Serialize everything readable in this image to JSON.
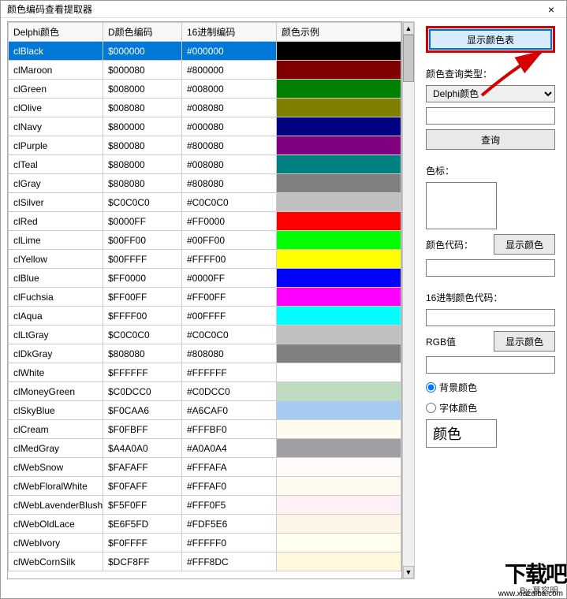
{
  "window": {
    "title": "颜色编码查看提取器",
    "close": "×"
  },
  "table": {
    "headers": [
      "Delphi颜色",
      "D颜色编码",
      "16进制编码",
      "颜色示例"
    ],
    "rows": [
      {
        "name": "clBlack",
        "dcode": "$000000",
        "hex": "#000000",
        "color": "#000000",
        "selected": true
      },
      {
        "name": "clMaroon",
        "dcode": "$000080",
        "hex": "#800000",
        "color": "#800000"
      },
      {
        "name": "clGreen",
        "dcode": "$008000",
        "hex": "#008000",
        "color": "#008000"
      },
      {
        "name": "clOlive",
        "dcode": "$008080",
        "hex": "#008080",
        "color": "#808000"
      },
      {
        "name": "clNavy",
        "dcode": "$800000",
        "hex": "#000080",
        "color": "#000080"
      },
      {
        "name": "clPurple",
        "dcode": "$800080",
        "hex": "#800080",
        "color": "#800080"
      },
      {
        "name": "clTeal",
        "dcode": "$808000",
        "hex": "#008080",
        "color": "#008080"
      },
      {
        "name": "clGray",
        "dcode": "$808080",
        "hex": "#808080",
        "color": "#808080"
      },
      {
        "name": "clSilver",
        "dcode": "$C0C0C0",
        "hex": "#C0C0C0",
        "color": "#C0C0C0"
      },
      {
        "name": "clRed",
        "dcode": "$0000FF",
        "hex": "#FF0000",
        "color": "#FF0000"
      },
      {
        "name": "clLime",
        "dcode": "$00FF00",
        "hex": "#00FF00",
        "color": "#00FF00"
      },
      {
        "name": "clYellow",
        "dcode": "$00FFFF",
        "hex": "#FFFF00",
        "color": "#FFFF00"
      },
      {
        "name": "clBlue",
        "dcode": "$FF0000",
        "hex": "#0000FF",
        "color": "#0000FF"
      },
      {
        "name": "clFuchsia",
        "dcode": "$FF00FF",
        "hex": "#FF00FF",
        "color": "#FF00FF"
      },
      {
        "name": "clAqua",
        "dcode": "$FFFF00",
        "hex": "#00FFFF",
        "color": "#00FFFF"
      },
      {
        "name": "clLtGray",
        "dcode": "$C0C0C0",
        "hex": "#C0C0C0",
        "color": "#C0C0C0"
      },
      {
        "name": "clDkGray",
        "dcode": "$808080",
        "hex": "#808080",
        "color": "#808080"
      },
      {
        "name": "clWhite",
        "dcode": "$FFFFFF",
        "hex": "#FFFFFF",
        "color": "#FFFFFF"
      },
      {
        "name": "clMoneyGreen",
        "dcode": "$C0DCC0",
        "hex": "#C0DCC0",
        "color": "#C0DCC0"
      },
      {
        "name": "clSkyBlue",
        "dcode": "$F0CAA6",
        "hex": "#A6CAF0",
        "color": "#A6CAF0"
      },
      {
        "name": "clCream",
        "dcode": "$F0FBFF",
        "hex": "#FFFBF0",
        "color": "#FFFBF0"
      },
      {
        "name": "clMedGray",
        "dcode": "$A4A0A0",
        "hex": "#A0A0A4",
        "color": "#A0A0A4"
      },
      {
        "name": "clWebSnow",
        "dcode": "$FAFAFF",
        "hex": "#FFFAFA",
        "color": "#FFFAFA"
      },
      {
        "name": "clWebFloralWhite",
        "dcode": "$F0FAFF",
        "hex": "#FFFAF0",
        "color": "#FFFAF0"
      },
      {
        "name": "clWebLavenderBlush",
        "dcode": "$F5F0FF",
        "hex": "#FFF0F5",
        "color": "#FFF0F5"
      },
      {
        "name": "clWebOldLace",
        "dcode": "$E6F5FD",
        "hex": "#FDF5E6",
        "color": "#FDF5E6"
      },
      {
        "name": "clWebIvory",
        "dcode": "$F0FFFF",
        "hex": "#FFFFF0",
        "color": "#FFFFF0"
      },
      {
        "name": "clWebCornSilk",
        "dcode": "$DCF8FF",
        "hex": "#FFF8DC",
        "color": "#FFF8DC"
      }
    ]
  },
  "panel": {
    "show_table_btn": "显示颜色表",
    "query_type_label": "颜色查询类型：",
    "query_type_value": "Delphi颜色",
    "query_btn": "查询",
    "swatch_label": "色标：",
    "color_code_label": "颜色代码：",
    "show_color_btn1": "显示颜色",
    "hex_code_label": "16进制颜色代码：",
    "rgb_label": "RGB值",
    "show_color_btn2": "显示颜色",
    "radio_bg": "背景颜色",
    "radio_font": "字体颜色",
    "font_sample": "颜色"
  },
  "footer": "By:慕容明",
  "watermark": {
    "logo": "下载吧",
    "url": "www.xiazaiba.com"
  }
}
